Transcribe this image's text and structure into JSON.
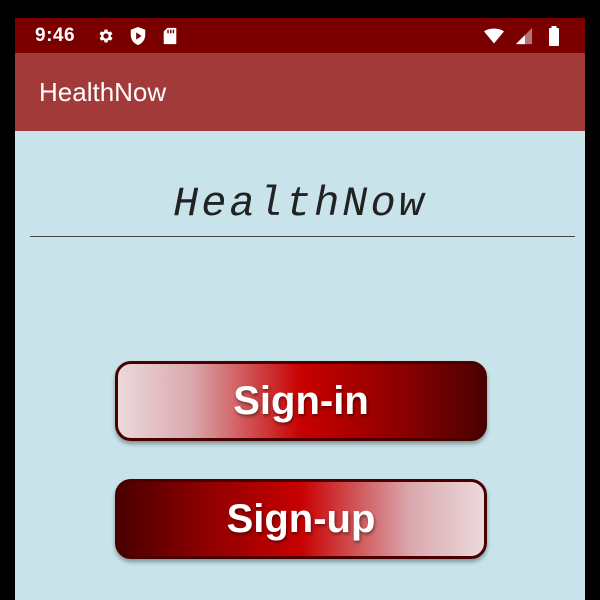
{
  "status_bar": {
    "time": "9:46",
    "left_icons": [
      "gear-icon",
      "shield-play-icon",
      "sd-card-icon"
    ],
    "right_icons": [
      "wifi-icon",
      "cell-signal-icon",
      "battery-icon"
    ],
    "background": "#7a0000"
  },
  "app_bar": {
    "title": "HealthNow",
    "background": "#a23a3a"
  },
  "main": {
    "logo_text": "HealthNow",
    "background": "#c8e4ea",
    "signin_label": "Sign-in",
    "signup_label": "Sign-up"
  },
  "colors": {
    "button_dark": "#4a0000",
    "button_mid": "#c80000",
    "button_light": "#ecd9dc"
  }
}
